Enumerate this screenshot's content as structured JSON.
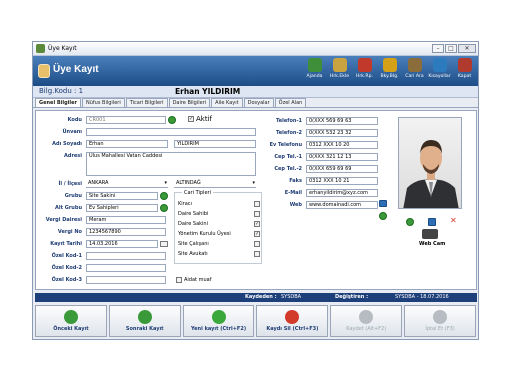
{
  "window": {
    "title": "Üye Kayıt"
  },
  "header": {
    "title": "Üye Kayıt",
    "tools": [
      {
        "label": "Ajanda",
        "icon": "tree-icon",
        "color": "#3f8f3a"
      },
      {
        "label": "Hrk.Ekle",
        "icon": "add-movement-icon",
        "color": "#c9a340"
      },
      {
        "label": "Hrk.Rp.",
        "icon": "report-icon",
        "color": "#c0392b"
      },
      {
        "label": "Bky.Blg.",
        "icon": "balance-icon",
        "color": "#d4a017"
      },
      {
        "label": "Cari Ara",
        "icon": "search-icon",
        "color": "#8a6d3b"
      },
      {
        "label": "Kısayollar",
        "icon": "shortcuts-icon",
        "color": "#2c7bbf"
      },
      {
        "label": "Kapat",
        "icon": "close-door-icon",
        "color": "#b03a2e"
      }
    ]
  },
  "id": {
    "label": "Bilg.Kodu : 1",
    "name": "Erhan YILDIRIM"
  },
  "tabs": [
    "Genel Bilgiler",
    "Nüfus Bilgileri",
    "Ticari Bilgileri",
    "Daire Bilgileri",
    "Aile Kayıt",
    "Dosyalar",
    "Özel Alan"
  ],
  "form": {
    "kod_label": "Kodu",
    "kod": "CR001",
    "aktif": "Aktif",
    "unvan_label": "Ünvanı",
    "unvan": "",
    "ad_label": "Adı Soyadı",
    "ad": "Erhan",
    "soyad": "YILDIRIM",
    "adres_label": "Adresi",
    "adres": "Ulus Mahallesi Vatan Caddesi",
    "il_label": "İl / İlçesi",
    "il": "ANKARA",
    "ilce": "ALTINDAĞ",
    "grup_label": "Grubu",
    "grup": "Site Sakini",
    "altgrup_label": "Alt Grubu",
    "altgrup": "Ev Sahipleri",
    "vd_label": "Vergi Dairesi",
    "vd": "Meram",
    "vno_label": "Vergi No",
    "vno": "1234567890",
    "kt_label": "Kayıt Tarihi",
    "kt": "14.03.2016",
    "ok1_label": "Özel Kod-1",
    "ok2_label": "Özel Kod-2",
    "ok3_label": "Özel Kod-3",
    "cari_title": "Cari Tipleri",
    "cari": [
      "Kiracı",
      "Daire Sahibi",
      "Daire Sakini",
      "Yönetim Kurulu Üyesi",
      "Site Çalışanı",
      "Site Avukatı"
    ],
    "cari_checked": [
      false,
      false,
      true,
      true,
      false,
      false
    ],
    "aidat": "Aidat muaf"
  },
  "contact": [
    {
      "label": "Telefon-1",
      "value": "0(XXX 569 69 63"
    },
    {
      "label": "Telefon-2",
      "value": "0(XXX 532 23 32"
    },
    {
      "label": "Ev Telefonu",
      "value": "0312 XXX 10 20"
    },
    {
      "label": "Cep Tel.-1",
      "value": "0(XXX 321 12 13"
    },
    {
      "label": "Cep Tel.-2",
      "value": "0(XXX 659 69 69"
    },
    {
      "label": "Faks",
      "value": "0312 XXX 10 21"
    },
    {
      "label": "E-Mail",
      "value": "erhanyildirim@xyz.com"
    },
    {
      "label": "Web",
      "value": "www.domainadi.com"
    }
  ],
  "photo": {
    "webcam": "Web Cam"
  },
  "status": {
    "kaydeden_label": "Kaydeden :",
    "kaydeden": "SYSDBA",
    "degistiren_label": "Değiştiren :",
    "degistiren": "SYSDBA - 18.07.2016"
  },
  "buttons": [
    {
      "label": "Önceki Kayıt",
      "color": "#3a9a3a",
      "icon": "arrow-left-icon",
      "enabled": true
    },
    {
      "label": "Sonraki Kayıt",
      "color": "#3a9a3a",
      "icon": "arrow-right-icon",
      "enabled": true
    },
    {
      "label": "Yeni kayıt (Ctrl+F2)",
      "color": "#3aa83a",
      "icon": "plus-icon",
      "enabled": true
    },
    {
      "label": "Kaydı Sil (Ctrl+F3)",
      "color": "#d23a2a",
      "icon": "minus-icon",
      "enabled": true
    },
    {
      "label": "Kaydet (Alt+F2)",
      "color": "#b7bcc3",
      "icon": "check-icon",
      "enabled": false
    },
    {
      "label": "İptal Et (F3)",
      "color": "#b7bcc3",
      "icon": "x-icon",
      "enabled": false
    }
  ]
}
